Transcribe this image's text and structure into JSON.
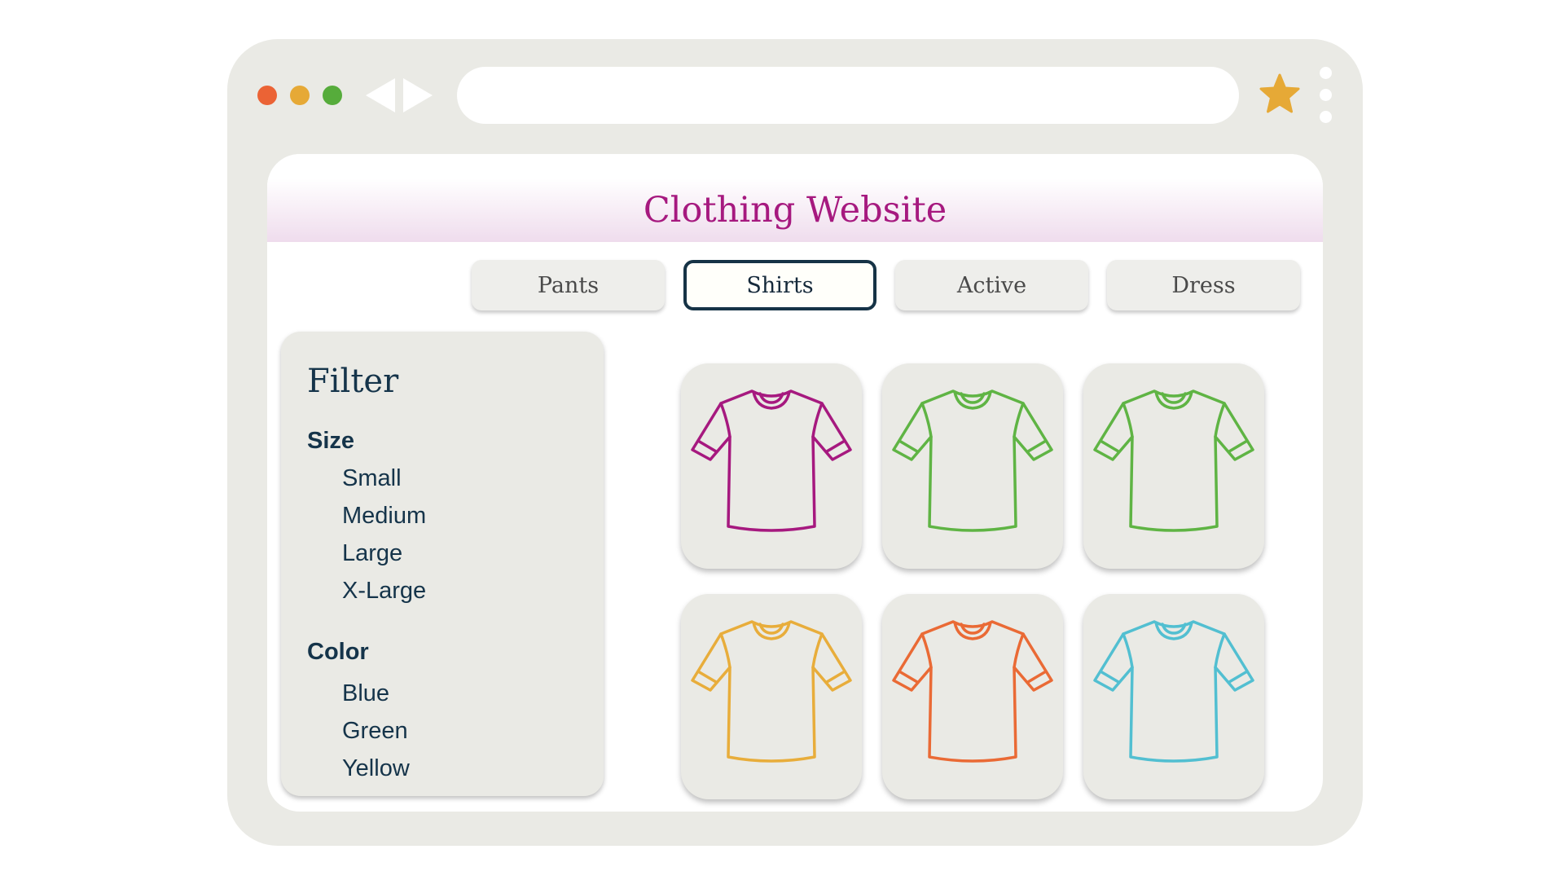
{
  "window": {
    "controls": [
      {
        "name": "close",
        "color": "#eb6335"
      },
      {
        "name": "minimize",
        "color": "#e6a936"
      },
      {
        "name": "maximize",
        "color": "#56ac3b"
      }
    ],
    "address": "",
    "bookmark_color": "#e6a936"
  },
  "site": {
    "title": "Clothing Website",
    "title_color": "#a6197f"
  },
  "tabs": [
    {
      "label": "Pants",
      "active": false
    },
    {
      "label": "Shirts",
      "active": true
    },
    {
      "label": "Active",
      "active": false
    },
    {
      "label": "Dress",
      "active": false
    }
  ],
  "filter": {
    "title": "Filter",
    "size": {
      "heading": "Size",
      "options": [
        "Small",
        "Medium",
        "Large",
        "X-Large"
      ]
    },
    "color": {
      "heading": "Color",
      "options": [
        "Blue",
        "Green",
        "Yellow"
      ]
    }
  },
  "products": [
    {
      "icon": "tshirt-icon",
      "color": "#a6197f"
    },
    {
      "icon": "tshirt-icon",
      "color": "#5fb444"
    },
    {
      "icon": "tshirt-icon",
      "color": "#5fb444"
    },
    {
      "icon": "tshirt-icon",
      "color": "#e8ad3b"
    },
    {
      "icon": "tshirt-icon",
      "color": "#ea6a35"
    },
    {
      "icon": "tshirt-icon",
      "color": "#52bfd1"
    }
  ]
}
